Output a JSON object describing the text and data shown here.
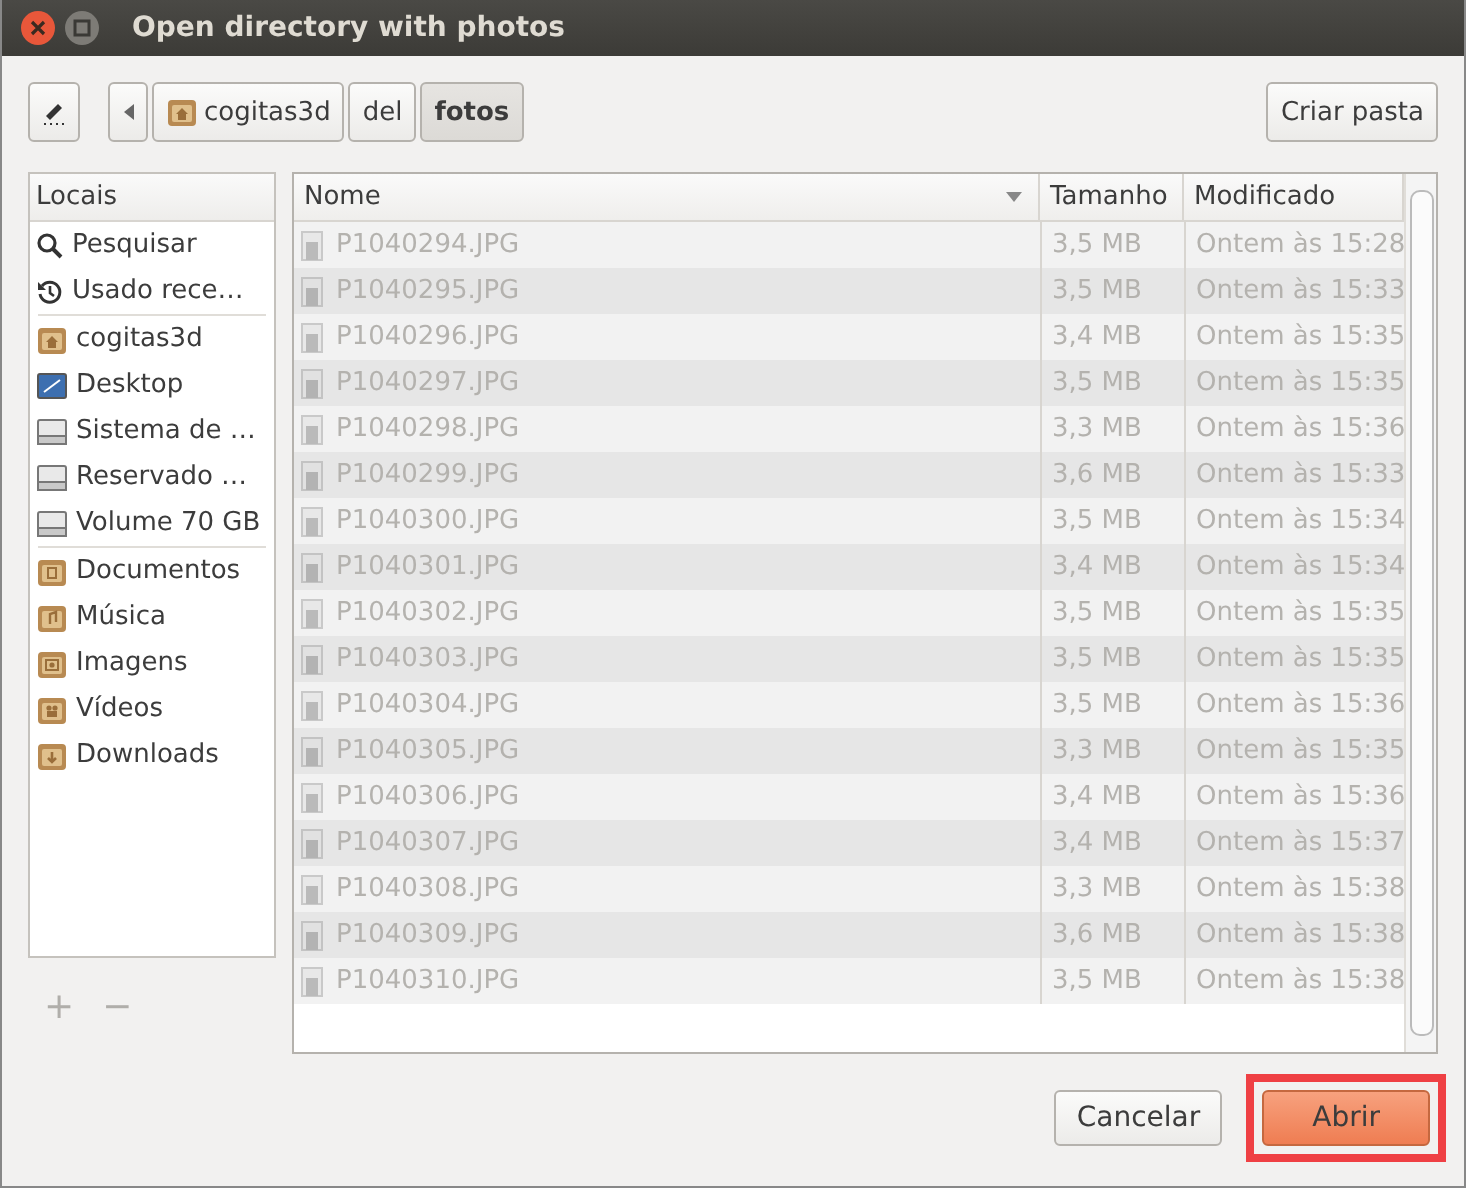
{
  "window": {
    "title": "Open directory with photos"
  },
  "path_bar": {
    "segments": [
      {
        "label": "cogitas3d",
        "kind": "home",
        "selected": false
      },
      {
        "label": "del",
        "kind": "plain",
        "selected": false
      },
      {
        "label": "fotos",
        "kind": "plain",
        "selected": true
      }
    ]
  },
  "create_folder_button": "Criar pasta",
  "sidebar": {
    "heading": "Locais",
    "sections": [
      [
        {
          "label": "Pesquisar",
          "kind": "search"
        },
        {
          "label": "Usado rece…",
          "kind": "recent"
        }
      ],
      [
        {
          "label": "cogitas3d",
          "kind": "home"
        },
        {
          "label": "Desktop",
          "kind": "desktop"
        },
        {
          "label": "Sistema de …",
          "kind": "drive"
        },
        {
          "label": "Reservado …",
          "kind": "drive"
        },
        {
          "label": "Volume 70 GB",
          "kind": "drive"
        }
      ],
      [
        {
          "label": "Documentos",
          "kind": "documents"
        },
        {
          "label": "Música",
          "kind": "music"
        },
        {
          "label": "Imagens",
          "kind": "pictures"
        },
        {
          "label": "Vídeos",
          "kind": "videos"
        },
        {
          "label": "Downloads",
          "kind": "downloads"
        }
      ]
    ],
    "add_button": "+",
    "remove_button": "−"
  },
  "table": {
    "columns": [
      "Nome",
      "Tamanho",
      "Modificado"
    ],
    "rows": [
      {
        "name": "P1040294.JPG",
        "size": "3,5 MB",
        "modified": "Ontem às 15:28",
        "disabled": true
      },
      {
        "name": "P1040295.JPG",
        "size": "3,5 MB",
        "modified": "Ontem às 15:33",
        "disabled": true
      },
      {
        "name": "P1040296.JPG",
        "size": "3,4 MB",
        "modified": "Ontem às 15:35",
        "disabled": true
      },
      {
        "name": "P1040297.JPG",
        "size": "3,5 MB",
        "modified": "Ontem às 15:35",
        "disabled": true
      },
      {
        "name": "P1040298.JPG",
        "size": "3,3 MB",
        "modified": "Ontem às 15:36",
        "disabled": true
      },
      {
        "name": "P1040299.JPG",
        "size": "3,6 MB",
        "modified": "Ontem às 15:33",
        "disabled": true
      },
      {
        "name": "P1040300.JPG",
        "size": "3,5 MB",
        "modified": "Ontem às 15:34",
        "disabled": true
      },
      {
        "name": "P1040301.JPG",
        "size": "3,4 MB",
        "modified": "Ontem às 15:34",
        "disabled": true
      },
      {
        "name": "P1040302.JPG",
        "size": "3,5 MB",
        "modified": "Ontem às 15:35",
        "disabled": true
      },
      {
        "name": "P1040303.JPG",
        "size": "3,5 MB",
        "modified": "Ontem às 15:35",
        "disabled": true
      },
      {
        "name": "P1040304.JPG",
        "size": "3,5 MB",
        "modified": "Ontem às 15:36",
        "disabled": true
      },
      {
        "name": "P1040305.JPG",
        "size": "3,3 MB",
        "modified": "Ontem às 15:35",
        "disabled": true
      },
      {
        "name": "P1040306.JPG",
        "size": "3,4 MB",
        "modified": "Ontem às 15:36",
        "disabled": true
      },
      {
        "name": "P1040307.JPG",
        "size": "3,4 MB",
        "modified": "Ontem às 15:37",
        "disabled": true
      },
      {
        "name": "P1040308.JPG",
        "size": "3,3 MB",
        "modified": "Ontem às 15:38",
        "disabled": true
      },
      {
        "name": "P1040309.JPG",
        "size": "3,6 MB",
        "modified": "Ontem às 15:38",
        "disabled": true
      },
      {
        "name": "P1040310.JPG",
        "size": "3,5 MB",
        "modified": "Ontem às 15:38",
        "disabled": true
      }
    ]
  },
  "buttons": [
    {
      "label": "Cancelar",
      "kind": "normal",
      "highlighted": false
    },
    {
      "label": "Abrir",
      "kind": "primary",
      "highlighted": true
    }
  ]
}
